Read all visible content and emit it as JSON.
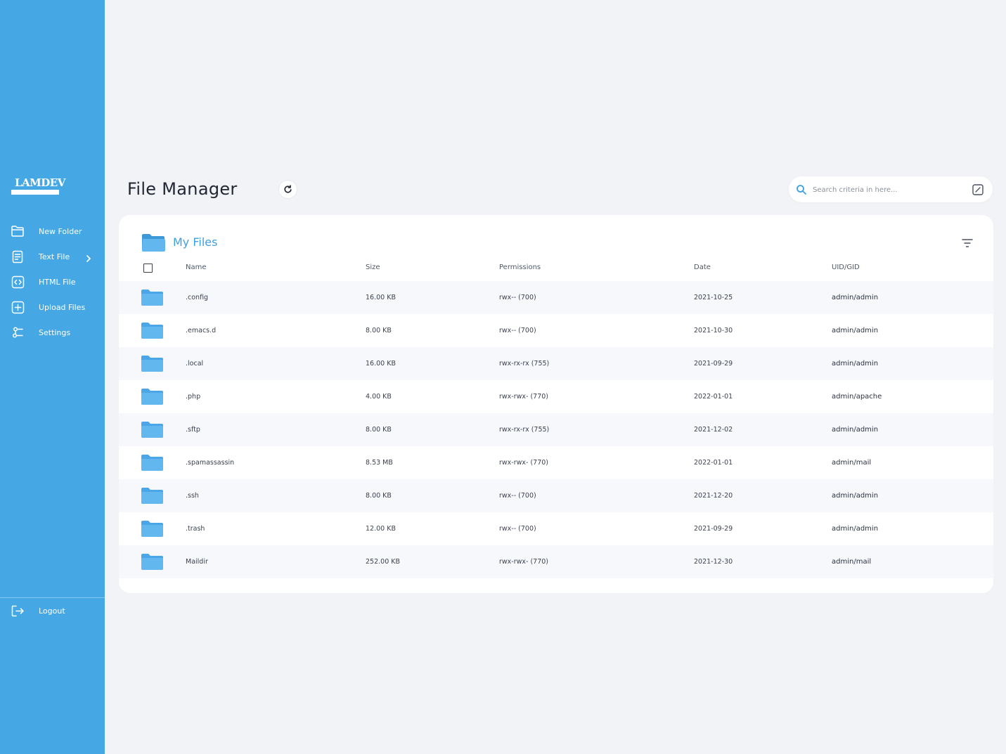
{
  "sidebar": {
    "logo": "LAMDEV",
    "items": [
      {
        "label": "New Folder",
        "icon": "folder-icon"
      },
      {
        "label": "Text File",
        "icon": "text-file-icon"
      },
      {
        "label": "HTML File",
        "icon": "html-file-icon"
      },
      {
        "label": "Upload Files",
        "icon": "upload-icon"
      },
      {
        "label": "Settings",
        "icon": "settings-icon"
      }
    ],
    "logout": "Logout"
  },
  "header": {
    "title": "File Manager",
    "search_placeholder": "Search criteria in here..."
  },
  "files": {
    "title": "My Files",
    "columns": {
      "name": "Name",
      "size": "Size",
      "permissions": "Permissions",
      "date": "Date",
      "uid": "UID/GID"
    },
    "rows": [
      {
        "name": ".config",
        "size": "16.00 KB",
        "permissions": "rwx-- (700)",
        "date": "2021-10-25",
        "uid": "admin/admin"
      },
      {
        "name": ".emacs.d",
        "size": "8.00 KB",
        "permissions": "rwx-- (700)",
        "date": "2021-10-30",
        "uid": "admin/admin"
      },
      {
        "name": ".local",
        "size": "16.00 KB",
        "permissions": "rwx-rx-rx (755)",
        "date": "2021-09-29",
        "uid": "admin/admin"
      },
      {
        "name": ".php",
        "size": "4.00 KB",
        "permissions": "rwx-rwx- (770)",
        "date": "2022-01-01",
        "uid": "admin/apache"
      },
      {
        "name": ".sftp",
        "size": "8.00 KB",
        "permissions": "rwx-rx-rx (755)",
        "date": "2021-12-02",
        "uid": "admin/admin"
      },
      {
        "name": ".spamassassin",
        "size": "8.53 MB",
        "permissions": "rwx-rwx- (770)",
        "date": "2022-01-01",
        "uid": "admin/mail"
      },
      {
        "name": ".ssh",
        "size": "8.00 KB",
        "permissions": "rwx-- (700)",
        "date": "2021-12-20",
        "uid": "admin/admin"
      },
      {
        "name": ".trash",
        "size": "12.00 KB",
        "permissions": "rwx-- (700)",
        "date": "2021-09-29",
        "uid": "admin/admin"
      },
      {
        "name": "Maildir",
        "size": "252.00 KB",
        "permissions": "rwx-rwx- (770)",
        "date": "2021-12-30",
        "uid": "admin/mail"
      }
    ]
  },
  "colors": {
    "sidebar": "#45a8e5",
    "accent": "#3da0df",
    "folder": "#62b7ef",
    "background": "#f1f3f7"
  }
}
